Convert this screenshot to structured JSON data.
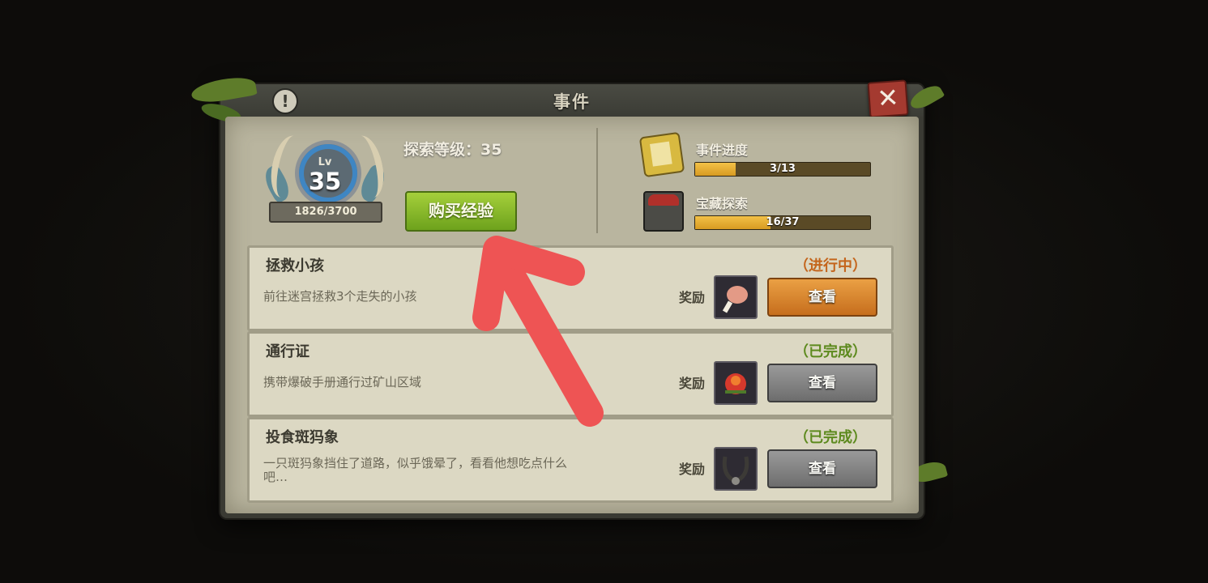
{
  "dialog": {
    "title": "事件",
    "info_icon": "exclamation-icon",
    "close_icon": "close-x-icon"
  },
  "header": {
    "lv_label": "Lv",
    "level": "35",
    "xp_text": "1826/3700",
    "xp_progress": 0.4935,
    "explore_level_text": "探索等级：35",
    "buy_exp_label": "购买经验"
  },
  "stats": [
    {
      "label": "事件进度",
      "icon": "document-icon",
      "value_text": "3/13",
      "progress": 0.2308
    },
    {
      "label": "宝藏探索",
      "icon": "treasure-chest-icon",
      "value_text": "16/37",
      "progress": 0.4324
    }
  ],
  "quests": [
    {
      "title": "拯救小孩",
      "status": "（进行中）",
      "status_color": "#c4651c",
      "description": "前往迷宫拯救3个走失的小孩",
      "reward_label": "奖励",
      "reward_icon": "meat-drumstick-icon",
      "view_label": "查看",
      "view_style": "orange"
    },
    {
      "title": "通行证",
      "status": "（已完成）",
      "status_color": "#5d8a1e",
      "description": "携带爆破手册通行过矿山区域",
      "reward_label": "奖励",
      "reward_icon": "red-fruit-icon",
      "view_label": "查看",
      "view_style": "gray"
    },
    {
      "title": "投食斑犸象",
      "status": "（已完成）",
      "status_color": "#5d8a1e",
      "description": "一只斑犸象挡住了道路，似乎饿晕了，看看他想吃点什么吧…",
      "reward_label": "奖励",
      "reward_icon": "necklace-icon",
      "view_label": "查看",
      "view_style": "gray"
    }
  ],
  "annotation": {
    "arrow_color": "#ee5454",
    "arrow_icon": "red-arrow-annotation"
  }
}
